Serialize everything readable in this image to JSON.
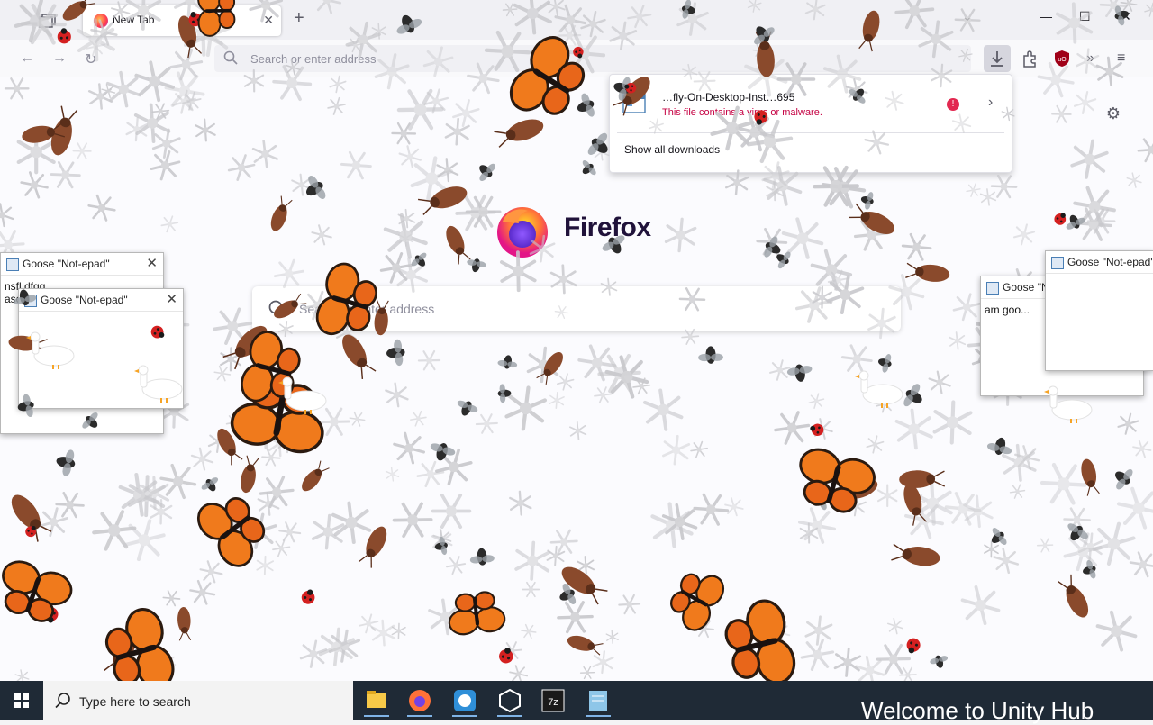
{
  "browser": {
    "tab_title": "New Tab",
    "url_placeholder": "Search or enter address",
    "logo_text": "Firefox",
    "hero_search_placeholder": "Search or enter address"
  },
  "downloads": {
    "file_name": "…fly-On-Desktop-Inst…695",
    "warning": "This file contains a virus or malware.",
    "show_all": "Show all downloads",
    "badge": "!"
  },
  "notepads": [
    {
      "title": "Goose \"Not-epad\"",
      "body": "nsfl dfgg ...\nasc"
    },
    {
      "title": "Goose \"Not-epad\"",
      "body": ""
    },
    {
      "title": "Goose \"Not-epad\"",
      "body": "am goo..."
    },
    {
      "title": "Goose \"Not-epad\"",
      "body": ""
    }
  ],
  "taskbar": {
    "search_placeholder": "Type here to search",
    "banner": "Welcome to Unity Hub",
    "apps": [
      "file-explorer",
      "firefox",
      "app-blue",
      "unity-hub",
      "7zip",
      "app-notes"
    ]
  },
  "colors": {
    "taskbar": "#1f2a36",
    "warning": "#c50042",
    "monarch": "#f07a1c",
    "roach": "#8a4a2c"
  }
}
